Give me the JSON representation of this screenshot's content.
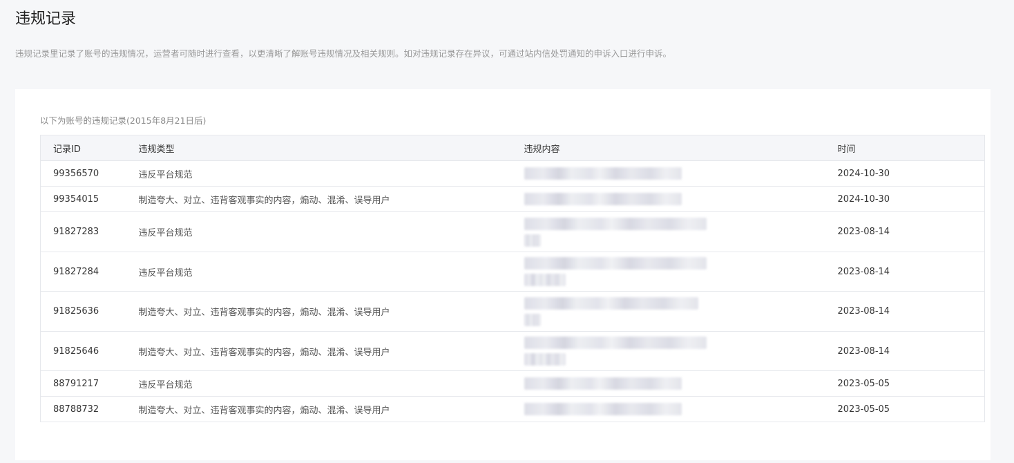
{
  "header": {
    "title": "违规记录",
    "description": "违规记录里记录了账号的违规情况，运营者可随时进行查看，以更清晰了解账号违规情况及相关规则。如对违规记录存在异议，可通过站内信处罚通知的申诉入口进行申诉。"
  },
  "records": {
    "caption": "以下为账号的违规记录(2015年8月21日后)",
    "columns": {
      "id": "记录ID",
      "type": "违规类型",
      "content": "违规内容",
      "time": "时间"
    },
    "rows": [
      {
        "id": "99356570",
        "type": "违反平台规范",
        "time": "2024-10-30"
      },
      {
        "id": "99354015",
        "type": "制造夸大、对立、违背客观事实的内容，煽动、混淆、误导用户",
        "time": "2024-10-30"
      },
      {
        "id": "91827283",
        "type": "违反平台规范",
        "time": "2023-08-14"
      },
      {
        "id": "91827284",
        "type": "违反平台规范",
        "time": "2023-08-14"
      },
      {
        "id": "91825636",
        "type": "制造夸大、对立、违背客观事实的内容，煽动、混淆、误导用户",
        "time": "2023-08-14"
      },
      {
        "id": "91825646",
        "type": "制造夸大、对立、违背客观事实的内容，煽动、混淆、误导用户",
        "time": "2023-08-14"
      },
      {
        "id": "88791217",
        "type": "违反平台规范",
        "time": "2023-05-05"
      },
      {
        "id": "88788732",
        "type": "制造夸大、对立、违背客观事实的内容，煽动、混淆、误导用户",
        "time": "2023-05-05"
      }
    ]
  }
}
